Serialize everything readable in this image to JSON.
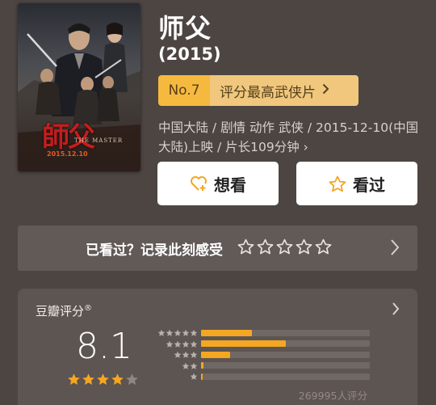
{
  "movie": {
    "title": "师父",
    "year": "(2015)",
    "poster": {
      "title_art": "師父",
      "subtitle": "THE MASTER",
      "release_text": "2015.12.10"
    },
    "rank": {
      "number": "No.7",
      "label": "评分最高武侠片",
      "chevron_icon": "chevron-right-icon"
    },
    "meta_text": "中国大陆 / 剧情 动作 武侠 / 2015-12-10(中国大陆)上映 / 片长109分钟 ›"
  },
  "actions": {
    "want_label": "想看",
    "want_icon": "heart-add-icon",
    "seen_label": "看过",
    "seen_icon": "star-outline-icon"
  },
  "record": {
    "prompt": "已看过？记录此刻感受",
    "star_count": 5,
    "chevron_icon": "chevron-right-icon"
  },
  "rating": {
    "title": "豆瓣评分",
    "trademark": "®",
    "score": "8.1",
    "stars_filled": 4,
    "stars_total": 5,
    "distribution": [
      {
        "stars": 5,
        "fraction": 0.3
      },
      {
        "stars": 4,
        "fraction": 0.5
      },
      {
        "stars": 3,
        "fraction": 0.17
      },
      {
        "stars": 2,
        "fraction": 0.015
      },
      {
        "stars": 1,
        "fraction": 0.008
      }
    ],
    "count_text": "269995人评分"
  },
  "colors": {
    "background": "#4d4542",
    "accent_orange": "#f5a623",
    "rank_badge": "#f6b93f",
    "rank_label_bg": "#f0c77d",
    "card_bg": "#5d5551"
  }
}
